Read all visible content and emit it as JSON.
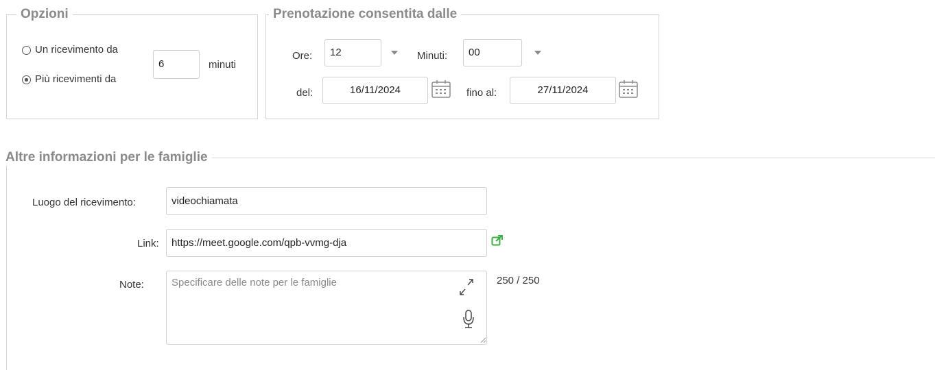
{
  "opzioni": {
    "legend": "Opzioni",
    "radio_single_label": "Un ricevimento da",
    "radio_multi_label": "Più ricevimenti da",
    "selected": "multi",
    "minutes_value": "6",
    "minutes_unit": "minuti"
  },
  "prenotazione": {
    "legend": "Prenotazione consentita dalle",
    "ore_label": "Ore:",
    "ore_value": "12",
    "minuti_label": "Minuti:",
    "minuti_value": "00",
    "del_label": "del:",
    "del_value": "16/11/2024",
    "fino_label": "fino al:",
    "fino_value": "27/11/2024"
  },
  "altre": {
    "legend": "Altre informazioni per le famiglie",
    "luogo_label": "Luogo del ricevimento:",
    "luogo_value": "videochiamata",
    "link_label": "Link:",
    "link_value": "https://meet.google.com/qpb-vvmg-dja",
    "note_label": "Note:",
    "note_placeholder": "Specificare delle note per le famiglie",
    "note_counter": "250 / 250"
  },
  "icons": {
    "external_link": "external-link-icon",
    "expand": "expand-icon",
    "microphone": "microphone-icon",
    "calendar": "calendar-icon",
    "resize": "resize-handle-icon"
  },
  "colors": {
    "legend": "#8a8a8a",
    "border": "#d4d4d4",
    "external_link": "#3cb043"
  }
}
